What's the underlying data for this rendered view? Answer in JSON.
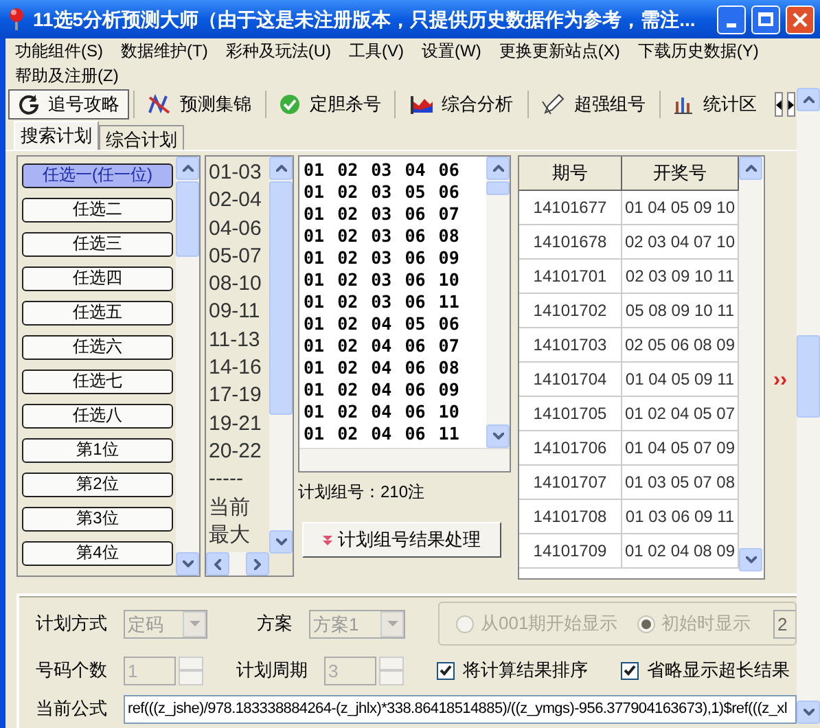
{
  "window": {
    "title": "11选5分析预测大师（由于这是未注册版本，只提供历史数据作为参考，需注..."
  },
  "menu": [
    "功能组件(S)",
    "数据维护(T)",
    "彩种及玩法(U)",
    "工具(V)",
    "设置(W)",
    "更换更新站点(X)",
    "下载历史数据(Y)",
    "帮助及注册(Z)"
  ],
  "toolbar": [
    {
      "label": "追号攻略",
      "selected": true
    },
    {
      "label": "预测集锦",
      "selected": false
    },
    {
      "label": "定胆杀号",
      "selected": false
    },
    {
      "label": "综合分析",
      "selected": false
    },
    {
      "label": "超强组号",
      "selected": false
    },
    {
      "label": "统计区",
      "selected": false
    }
  ],
  "tabs": [
    {
      "label": "搜索计划",
      "selected": true
    },
    {
      "label": "综合计划",
      "selected": false
    }
  ],
  "play_types": [
    {
      "label": "任选一(任一位)",
      "selected": true
    },
    {
      "label": "任选二",
      "selected": false
    },
    {
      "label": "任选三",
      "selected": false
    },
    {
      "label": "任选四",
      "selected": false
    },
    {
      "label": "任选五",
      "selected": false
    },
    {
      "label": "任选六",
      "selected": false
    },
    {
      "label": "任选七",
      "selected": false
    },
    {
      "label": "任选八",
      "selected": false
    },
    {
      "label": "第1位",
      "selected": false
    },
    {
      "label": "第2位",
      "selected": false
    },
    {
      "label": "第3位",
      "selected": false
    },
    {
      "label": "第4位",
      "selected": false
    }
  ],
  "ranges": [
    "01-03",
    "02-04",
    "04-06",
    "05-07",
    "08-10",
    "09-11",
    "11-13",
    "14-16",
    "17-19",
    "19-21",
    "20-22",
    "-----",
    "当前",
    "最大"
  ],
  "combinations": [
    "01 02 03 04 06",
    "01 02 03 05 06",
    "01 02 03 06 07",
    "01 02 03 06 08",
    "01 02 03 06 09",
    "01 02 03 06 10",
    "01 02 03 06 11",
    "01 02 04 05 06",
    "01 02 04 06 07",
    "01 02 04 06 08",
    "01 02 04 06 09",
    "01 02 04 06 10",
    "01 02 04 06 11"
  ],
  "combination_count": "计划组号：210注",
  "process_button": "计划组号结果处理",
  "table": {
    "columns": [
      "期号",
      "开奖号"
    ],
    "rows": [
      [
        "14101677",
        "01 04 05 09 10"
      ],
      [
        "14101678",
        "02 03 04 07 10"
      ],
      [
        "14101701",
        "02 03 09 10 11"
      ],
      [
        "14101702",
        "05 08 09 10 11"
      ],
      [
        "14101703",
        "02 05 06 08 09"
      ],
      [
        "14101704",
        "01 04 05 09 11"
      ],
      [
        "14101705",
        "01 02 04 05 07"
      ],
      [
        "14101706",
        "01 04 05 07 09"
      ],
      [
        "14101707",
        "01 03 05 07 08"
      ],
      [
        "14101708",
        "01 03 06 09 11"
      ],
      [
        "14101709",
        "01 02 04 08 09"
      ]
    ]
  },
  "expand_marker": "››",
  "settings": {
    "plan_method": {
      "label": "计划方式",
      "value": "定码",
      "disabled": true
    },
    "scheme": {
      "label": "方案",
      "value": "方案1",
      "disabled": true
    },
    "radios": [
      {
        "label": "从001期开始显示",
        "selected": false,
        "disabled": true
      },
      {
        "label": "初始时显示",
        "selected": true,
        "disabled": true
      }
    ],
    "cut_field": "2",
    "number_count": {
      "label": "号码个数",
      "value": "1",
      "disabled": true
    },
    "plan_cycle": {
      "label": "计划周期",
      "value": "3",
      "disabled": true
    },
    "checkboxes": [
      {
        "label": "将计算结果排序",
        "checked": true
      },
      {
        "label": "省略显示超长结果",
        "checked": true
      }
    ],
    "formula": {
      "label": "当前公式",
      "value": "ref(((z_jshe)/978.183338884264-(z_jhlx)*338.86418514885)/((z_ymgs)-956.377904163673),1)$ref(((z_xl"
    }
  }
}
